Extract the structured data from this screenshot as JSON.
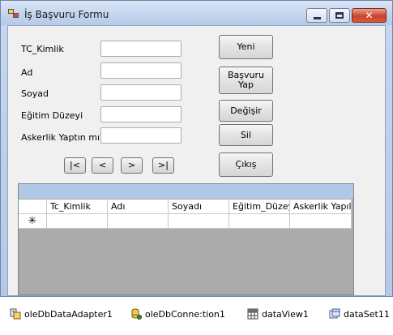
{
  "window": {
    "title": "İş Başvuru Formu"
  },
  "form": {
    "labels": {
      "tc": "TC_Kimlik",
      "ad": "Ad",
      "soyad": "Soyad",
      "egitim": "Eğitim Düzeyi",
      "askerlik": "Askerlik Yaptın mı?"
    },
    "values": {
      "tc": "",
      "ad": "",
      "soyad": "",
      "egitim": "",
      "askerlik": ""
    }
  },
  "buttons": {
    "yeni": "Yeni",
    "basvuru_line1": "Başvuru",
    "basvuru_line2": "Yap",
    "degistir": "Değişir",
    "sil": "Sil",
    "cikis": "Çıkış"
  },
  "navigation": {
    "first": "|<",
    "prev": "<",
    "next": ">",
    "last": ">|"
  },
  "grid": {
    "columns": [
      "Tc_Kimlik",
      "Adı",
      "Soyadı",
      "Eğitim_Düzey",
      "Askerlik Yapıl"
    ],
    "new_row_marker": "✳"
  },
  "tray": {
    "items": [
      {
        "label": "oleDbDataAdapter1",
        "icon": "data-adapter-icon"
      },
      {
        "label": "oleDbConne:tion1",
        "icon": "connection-icon"
      },
      {
        "label": "dataView1",
        "icon": "dataview-icon"
      },
      {
        "label": "dataSet11",
        "icon": "dataset-icon"
      }
    ]
  },
  "colors": {
    "title_bar": "#c2d4ee",
    "grid_background": "#ababab",
    "grid_top_bar": "#b1c7e6",
    "close_button": "#c8452c"
  }
}
